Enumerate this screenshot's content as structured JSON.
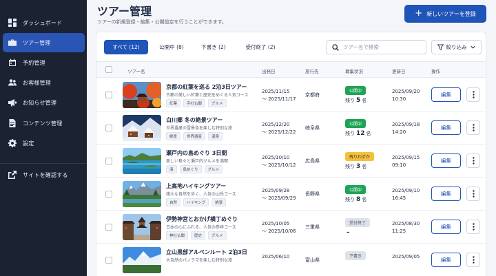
{
  "sidebar": {
    "items": [
      {
        "label": "ダッシュボード",
        "icon": "dashboard-icon"
      },
      {
        "label": "ツアー管理",
        "icon": "briefcase-icon",
        "active": true
      },
      {
        "label": "予約管理",
        "icon": "calendar-icon"
      },
      {
        "label": "お客様管理",
        "icon": "users-icon"
      },
      {
        "label": "お知らせ管理",
        "icon": "megaphone-icon"
      },
      {
        "label": "コンテンツ管理",
        "icon": "document-icon"
      },
      {
        "label": "設定",
        "icon": "gear-icon"
      }
    ],
    "external_link": {
      "label": "サイトを確認する",
      "icon": "external-link-icon"
    }
  },
  "header": {
    "title": "ツアー管理",
    "subtitle": "ツアーの新規登録・編集・公開設定を行うことができます。",
    "new_button": "新しいツアーを登録"
  },
  "tabs": [
    {
      "label": "すべて (12)",
      "active": true
    },
    {
      "label": "公開中 (8)"
    },
    {
      "label": "下書き (2)"
    },
    {
      "label": "受付終了 (2)"
    }
  ],
  "search": {
    "placeholder": "ツアー名で検索"
  },
  "filter_button": "絞り込み",
  "columns": {
    "name": "ツアー名",
    "departure": "出発日",
    "destination": "旅行先",
    "status": "募集状況",
    "updated": "更新日",
    "actions": "操作"
  },
  "colors": {
    "accent": "#1f54b8",
    "sidebar": "#1b2333",
    "published": "#1fa455",
    "low": "#f5c03a",
    "closed": "#dde2e9"
  },
  "rows": [
    {
      "name": "京都の紅葉を巡る 2泊3日ツアー",
      "desc": "古都の美しい紅葉と歴史をめぐる人気コース",
      "tags": [
        "紅葉",
        "寺社仏閣",
        "グルメ"
      ],
      "start": "2025/11/15",
      "end": "〜 2025/11/17",
      "pref": "京都府",
      "status": "公開中",
      "status_type": "green",
      "remain_prefix": "残り",
      "remain_num": "5",
      "remain_suffix": "名",
      "updated_date": "2025/09/20",
      "updated_time": "10:30",
      "thumb": "kyoto-autumn"
    },
    {
      "name": "白川郷 冬の絶景ツアー",
      "desc": "世界遺産の雪景色を楽しむ特別な旅",
      "tags": [
        "絶景",
        "世界遺産",
        "温泉"
      ],
      "start": "2025/12/20",
      "end": "〜 2025/12/22",
      "pref": "岐阜県",
      "status": "公開中",
      "status_type": "green",
      "remain_prefix": "残り",
      "remain_num": "12",
      "remain_suffix": "名",
      "updated_date": "2025/09/18",
      "updated_time": "14:20",
      "thumb": "shirakawago-snow"
    },
    {
      "name": "瀬戸内の島めぐり 3日間",
      "desc": "美しい島々と瀬戸内グルメを満喫",
      "tags": [
        "海",
        "島めぐり",
        "グルメ"
      ],
      "start": "2025/10/10",
      "end": "〜 2025/10/12",
      "pref": "広島県",
      "status": "残りわずか",
      "status_type": "yellow",
      "remain_prefix": "残り",
      "remain_num": "3",
      "remain_suffix": "名",
      "updated_date": "2025/09/15",
      "updated_time": "09:10",
      "thumb": "setouchi-islands"
    },
    {
      "name": "上高地ハイキングツアー",
      "desc": "雄大な自然を歩く、人気の山岳コース",
      "tags": [
        "自然",
        "ハイキング",
        "絶景"
      ],
      "start": "2025/09/28",
      "end": "〜 2025/09/29",
      "pref": "長野県",
      "status": "公開中",
      "status_type": "green",
      "remain_prefix": "残り",
      "remain_num": "8",
      "remain_suffix": "名",
      "updated_date": "2025/09/10",
      "updated_time": "16:45",
      "thumb": "kamikochi-mountains"
    },
    {
      "name": "伊勢神宮とおかげ横丁めぐり",
      "desc": "日本の心にふれる、人気の参拝コース",
      "tags": [
        "神社仏閣",
        "歴史",
        "グルメ"
      ],
      "start": "2025/10/05",
      "end": "〜 2025/10/06",
      "pref": "三重県",
      "status": "受付終了",
      "status_type": "gray",
      "remain_prefix": "",
      "remain_num": "–",
      "remain_suffix": "",
      "updated_date": "2025/08/30",
      "updated_time": "11:25",
      "thumb": "ise-street"
    },
    {
      "name": "立山黒部アルペンルート 2泊3日",
      "desc": "大自然のパノラマを楽しむ特別な旅",
      "tags": [],
      "start": "2025/06/10",
      "end": "",
      "pref": "富山県",
      "status": "下書き",
      "status_type": "gray",
      "remain_prefix": "",
      "remain_num": "",
      "remain_suffix": "",
      "updated_date": "2025/09/05",
      "updated_time": "",
      "thumb": "tateyama-alps"
    }
  ],
  "edit_label": "編集"
}
